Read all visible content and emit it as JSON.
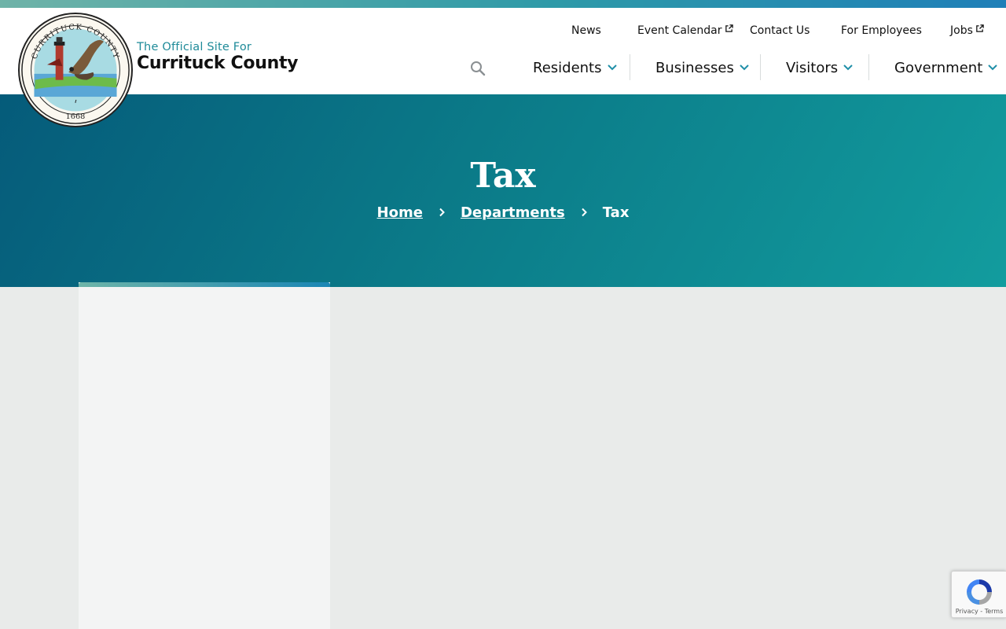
{
  "site": {
    "tagline": "The Official Site For",
    "title": "Currituck County",
    "seal_top_text": "CURRITUCK COUNTY",
    "seal_year": "1668"
  },
  "utility_nav": [
    {
      "label": "News",
      "external": false
    },
    {
      "label": "Event Calendar",
      "external": true
    },
    {
      "label": "Contact Us",
      "external": false
    },
    {
      "label": "For Employees",
      "external": false
    },
    {
      "label": "Jobs",
      "external": true
    }
  ],
  "main_nav": [
    {
      "label": "Residents"
    },
    {
      "label": "Businesses"
    },
    {
      "label": "Visitors"
    },
    {
      "label": "Government"
    }
  ],
  "hero": {
    "title": "Tax",
    "breadcrumb": [
      {
        "label": "Home",
        "link": true
      },
      {
        "label": "Departments",
        "link": true
      },
      {
        "label": "Tax",
        "link": false
      }
    ]
  },
  "recaptcha": {
    "privacy": "Privacy",
    "terms": "Terms",
    "separator": " - "
  },
  "colors": {
    "accent_teal": "#1f8b99",
    "hero_start": "#055b7a",
    "hero_end": "#129c9e",
    "nav_chevron": "#1f8fa8"
  },
  "icons": {
    "search": "search-icon",
    "external": "external-link-icon",
    "chevron": "chevron-down-icon",
    "breadcrumb_sep": "chevron-right-icon"
  }
}
